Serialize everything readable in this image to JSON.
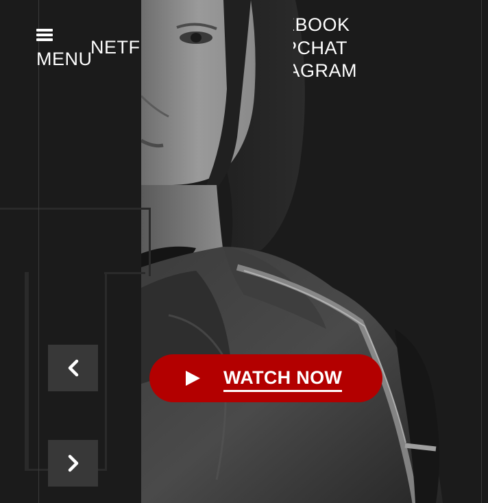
{
  "header": {
    "menu_label": "MENU",
    "brand_link": "NETFLIX",
    "social_links": [
      "FACEBOOK",
      "SNAPCHAT",
      "INSTAGRAM"
    ]
  },
  "hero": {
    "watch_label": "WATCH NOW",
    "image_icon": "portrait-photo"
  },
  "controls": {
    "prev_icon": "chevron-left-icon",
    "next_icon": "chevron-right-icon"
  },
  "colors": {
    "background": "#1b1b1b",
    "accent": "#b30000",
    "arrow_bg": "#383838"
  }
}
